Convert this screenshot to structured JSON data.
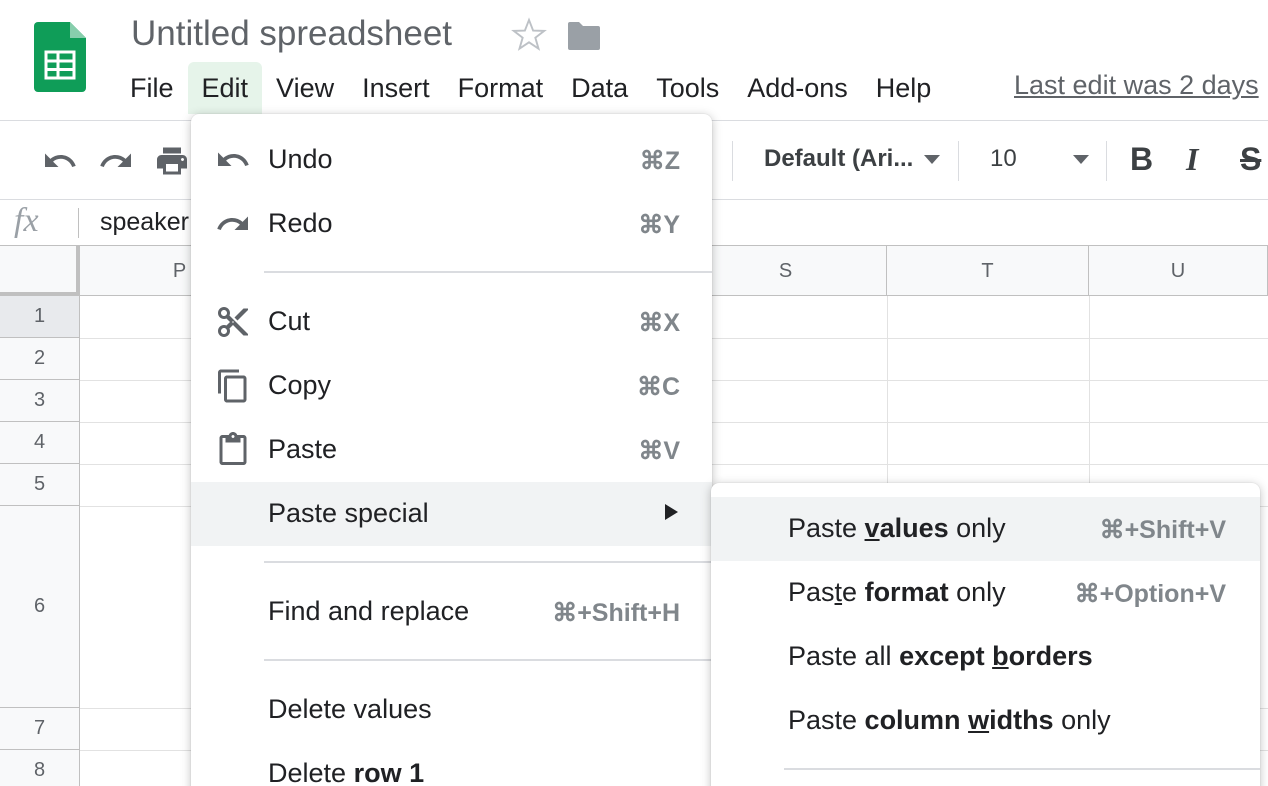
{
  "header": {
    "title": "Untitled spreadsheet",
    "last_edit": "Last edit was 2 days",
    "menu": [
      "File",
      "Edit",
      "View",
      "Insert",
      "Format",
      "Data",
      "Tools",
      "Add-ons",
      "Help"
    ],
    "active_menu": "Edit",
    "brand_color": "#0f9d58"
  },
  "toolbar": {
    "font": "Default (Ari...",
    "font_size": "10",
    "bold": "B",
    "italic": "I",
    "strike": "S"
  },
  "formula_bar": {
    "fx": "fx",
    "value": "speaker"
  },
  "grid": {
    "columns": [
      "P",
      "S",
      "T",
      "U"
    ],
    "rows": [
      "1",
      "2",
      "3",
      "4",
      "5",
      "6",
      "7",
      "8"
    ],
    "selected_row": "1"
  },
  "edit_menu": {
    "undo": {
      "label": "Undo",
      "shortcut": "⌘Z"
    },
    "redo": {
      "label": "Redo",
      "shortcut": "⌘Y"
    },
    "cut": {
      "label": "Cut",
      "shortcut": "⌘X"
    },
    "copy": {
      "label": "Copy",
      "shortcut": "⌘C"
    },
    "paste": {
      "label": "Paste",
      "shortcut": "⌘V"
    },
    "paste_special": {
      "label": "Paste special"
    },
    "find_replace": {
      "label": "Find and replace",
      "shortcut": "⌘+Shift+H"
    },
    "delete_values": {
      "label": "Delete values"
    },
    "delete_row": {
      "label_prefix": "Delete ",
      "label_bold": "row 1"
    }
  },
  "paste_special_menu": {
    "values_only": {
      "p1": "Paste ",
      "u": "v",
      "b_rest": "alues",
      "p2": " only",
      "shortcut": "⌘+Shift+V"
    },
    "format_only": {
      "p1": "Pas",
      "u": "t",
      "p1b": "e ",
      "b": "format",
      "p2": " only",
      "shortcut": "⌘+Option+V"
    },
    "except_borders": {
      "p1": "Paste all ",
      "b1": "except ",
      "u": "b",
      "b2": "orders"
    },
    "column_widths": {
      "p1": "Paste ",
      "b1": "column ",
      "u": "w",
      "b2": "idths",
      "p2": " only"
    }
  }
}
